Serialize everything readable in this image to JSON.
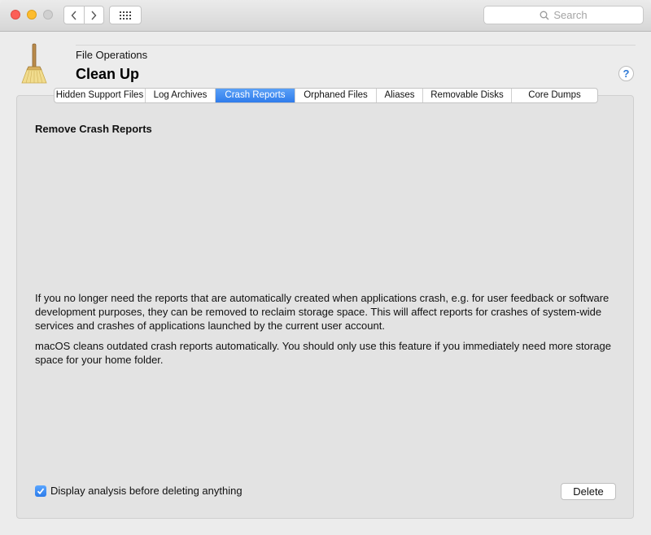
{
  "titlebar": {
    "buttons": [
      "close",
      "minimize",
      "zoom"
    ],
    "back_icon": "chevron-left-icon",
    "forward_icon": "chevron-right-icon",
    "grid_icon": "grid-icon",
    "search_placeholder": "Search"
  },
  "header": {
    "subtitle": "File Operations",
    "title": "Clean Up",
    "icon": "broom-icon",
    "help_label": "?"
  },
  "tabs": [
    {
      "label": "Hidden Support Files",
      "active": false
    },
    {
      "label": "Log Archives",
      "active": false
    },
    {
      "label": "Crash Reports",
      "active": true
    },
    {
      "label": "Orphaned Files",
      "active": false
    },
    {
      "label": "Aliases",
      "active": false
    },
    {
      "label": "Removable Disks",
      "active": false
    },
    {
      "label": "Core Dumps",
      "active": false
    }
  ],
  "content": {
    "section_title": "Remove Crash Reports",
    "paragraph1": "If you no longer need the reports that are automatically created when applications crash, e.g. for user feedback or software development purposes, they can be removed to reclaim storage space. This will affect reports for crashes of system-wide services and crashes of applications launched by the current user account.",
    "paragraph2": "macOS cleans outdated crash reports automatically. You should only use this feature if you immediately need more storage space for your home folder."
  },
  "footer": {
    "checkbox_label": "Display analysis before deleting anything",
    "checkbox_checked": true,
    "delete_label": "Delete"
  },
  "colors": {
    "accent": "#2f7ceb",
    "close": "#fc5f57",
    "minimize": "#fdbc2e"
  }
}
